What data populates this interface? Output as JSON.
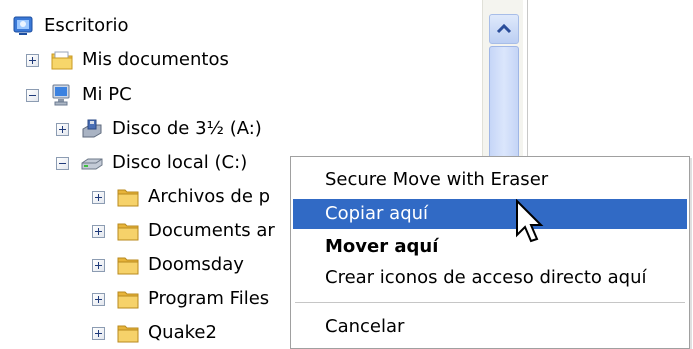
{
  "tree": {
    "items": [
      {
        "label": "Escritorio",
        "icon": "desktop-icon",
        "expander": "none"
      },
      {
        "label": "Mis documentos",
        "icon": "folder-icon",
        "expander": "plus"
      },
      {
        "label": "Mi PC",
        "icon": "computer-icon",
        "expander": "minus"
      },
      {
        "label": "Disco de 3½ (A:)",
        "icon": "floppy-drive-icon",
        "expander": "plus"
      },
      {
        "label": "Disco local (C:)",
        "icon": "hard-drive-icon",
        "expander": "minus"
      },
      {
        "label": "Archivos de p",
        "icon": "folder-icon",
        "expander": "plus"
      },
      {
        "label": "Documents ar",
        "icon": "folder-icon",
        "expander": "plus"
      },
      {
        "label": "Doomsday",
        "icon": "folder-icon",
        "expander": "plus"
      },
      {
        "label": "Program Files",
        "icon": "folder-icon",
        "expander": "plus"
      },
      {
        "label": "Quake2",
        "icon": "folder-icon",
        "expander": "plus"
      }
    ]
  },
  "context_menu": {
    "items": [
      {
        "label": "Secure Move with Eraser"
      },
      {
        "label": "Copiar aquí",
        "state": "highlighted"
      },
      {
        "label": "Mover aquí",
        "style": "bold"
      },
      {
        "label": "Crear iconos de acceso directo aquí"
      },
      {
        "label": "Cancelar"
      }
    ]
  },
  "colors": {
    "highlight": "#316ac5",
    "folder": "#f2c44a"
  },
  "icons": [
    "desktop-icon",
    "folder-icon",
    "computer-icon",
    "floppy-drive-icon",
    "hard-drive-icon",
    "scroll-up-arrow-icon",
    "mouse-cursor-icon"
  ]
}
